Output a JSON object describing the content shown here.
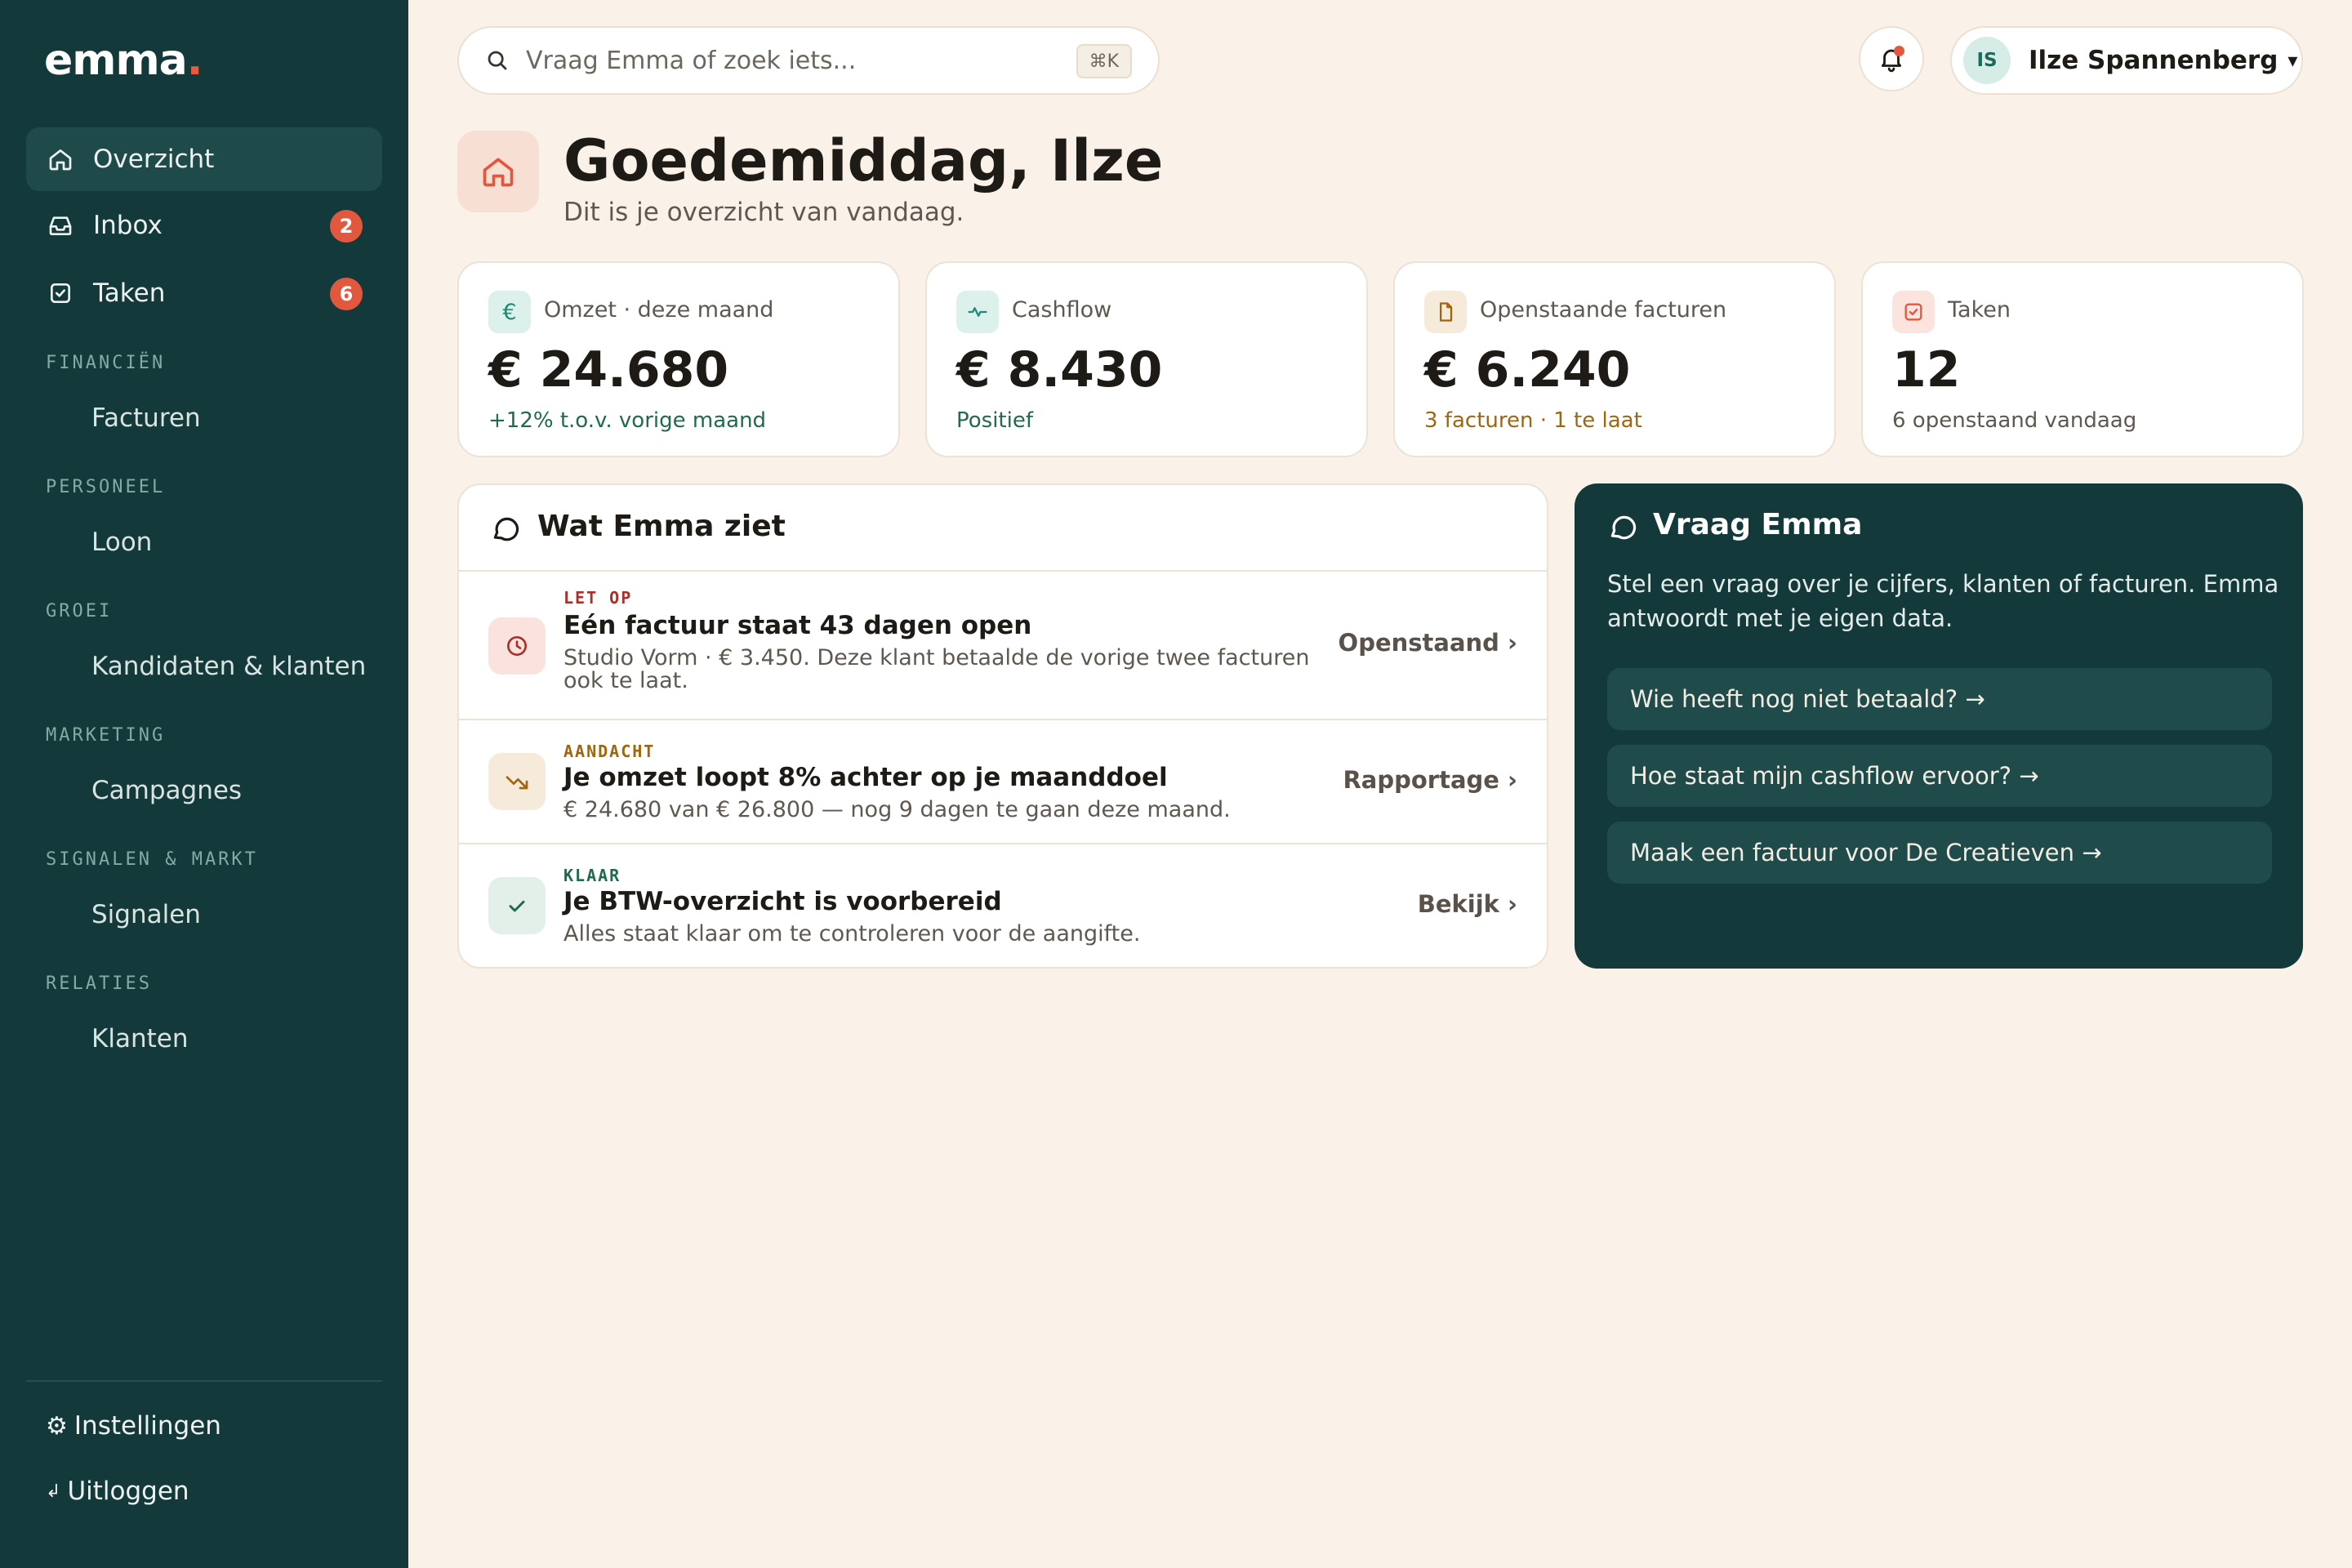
{
  "brand": {
    "name": "emma",
    "dot": "."
  },
  "sidebar": {
    "nav": [
      {
        "label": "Overzicht",
        "icon": "home-icon",
        "active": true
      },
      {
        "label": "Inbox",
        "icon": "inbox-icon",
        "badge": "2"
      },
      {
        "label": "Taken",
        "icon": "checkbox-icon",
        "badge": "6"
      }
    ],
    "sections": [
      {
        "label": "FINANCIËN",
        "items": [
          "Facturen"
        ]
      },
      {
        "label": "PERSONEEL",
        "items": [
          "Loon"
        ]
      },
      {
        "label": "GROEI",
        "items": [
          "Kandidaten & klanten"
        ]
      },
      {
        "label": "MARKETING",
        "items": [
          "Campagnes"
        ]
      },
      {
        "label": "SIGNALEN & MARKT",
        "items": [
          "Signalen"
        ]
      },
      {
        "label": "RELATIES",
        "items": [
          "Klanten"
        ]
      }
    ],
    "settings": {
      "icon": "⚙",
      "label": "Instellingen"
    },
    "logout": {
      "icon": "↲",
      "label": "Uitloggen"
    }
  },
  "topbar": {
    "search_placeholder": "Vraag Emma of zoek iets...",
    "shortcut": "⌘K",
    "user": {
      "initials": "IS",
      "name": "Ilze Spannenberg",
      "caret": "▾"
    }
  },
  "header": {
    "greeting": "Goedemiddag, Ilze",
    "subtitle": "Dit is je overzicht van vandaag."
  },
  "stats": [
    {
      "label": "Omzet · deze maand",
      "value": "€ 24.680",
      "note": "+12% t.o.v. vorige maand",
      "icon": "euro-icon"
    },
    {
      "label": "Cashflow",
      "value": "€ 8.430",
      "note": "Positief",
      "icon": "pulse-icon"
    },
    {
      "label": "Openstaande facturen",
      "value": "€ 6.240",
      "note": "3 facturen · 1 te laat",
      "icon": "document-icon"
    },
    {
      "label": "Taken",
      "value": "12",
      "note": "6 openstaand vandaag",
      "icon": "checkbox-icon"
    }
  ],
  "insights": {
    "title": "Wat Emma ziet",
    "items": [
      {
        "tag": "LET OP",
        "title": "Eén factuur staat 43 dagen open",
        "desc": "Studio Vorm · € 3.450. Deze klant betaalde de vorige twee facturen ook te laat.",
        "link": "Openstaand ›",
        "icon": "clock-icon"
      },
      {
        "tag": "AANDACHT",
        "title": "Je omzet loopt 8% achter op je maanddoel",
        "desc": "€ 24.680 van € 26.800 — nog 9 dagen te gaan deze maand.",
        "link": "Rapportage ›",
        "icon": "trend-down-icon"
      },
      {
        "tag": "KLAAR",
        "title": "Je BTW-overzicht is voorbereid",
        "desc": "Alles staat klaar om te controleren voor de aangifte.",
        "link": "Bekijk ›",
        "icon": "check-icon"
      }
    ]
  },
  "ask_emma": {
    "title": "Vraag Emma",
    "desc": "Stel een vraag over je cijfers, klanten of facturen. Emma antwoordt met je eigen data.",
    "prompts": [
      "Wie heeft nog niet betaald? →",
      "Hoe staat mijn cashflow ervoor? →",
      "Maak een factuur voor De Creatieven →"
    ]
  },
  "colors": {
    "sidebar_bg": "#13393a",
    "page_bg": "#faf2e9",
    "accent": "#e1583f",
    "positive": "#1f6b4a",
    "warning": "#a0660e",
    "danger": "#a8322a"
  }
}
